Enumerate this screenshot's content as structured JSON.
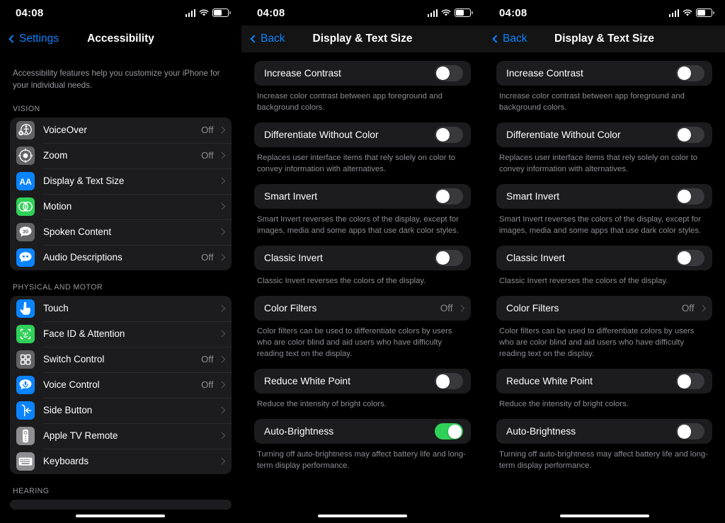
{
  "colors": {
    "accent_blue": "#0a84ff",
    "toggle_on_green": "#30d158",
    "card_bg": "#1c1c1e",
    "secondary_text": "#8d8d93",
    "screen_bg": "#000000"
  },
  "status_bar": {
    "time": "04:08",
    "signal_icon": "cellular-signal-icon",
    "wifi_icon": "wifi-icon",
    "battery_icon": "battery-icon"
  },
  "panel1": {
    "nav": {
      "back_label": "Settings",
      "title": "Accessibility"
    },
    "intro": "Accessibility features help you customize your iPhone for your individual needs.",
    "sections": [
      {
        "header": "VISION",
        "rows": [
          {
            "label": "VoiceOver",
            "value": "Off",
            "icon": "voiceover-icon",
            "icon_bg": "#636366"
          },
          {
            "label": "Zoom",
            "value": "Off",
            "icon": "zoom-icon",
            "icon_bg": "#636366"
          },
          {
            "label": "Display & Text Size",
            "value": "",
            "icon": "display-text-size-icon",
            "icon_bg": "#0a84ff"
          },
          {
            "label": "Motion",
            "value": "",
            "icon": "motion-icon",
            "icon_bg": "#30d158"
          },
          {
            "label": "Spoken Content",
            "value": "",
            "icon": "spoken-content-icon",
            "icon_bg": "#636366"
          },
          {
            "label": "Audio Descriptions",
            "value": "Off",
            "icon": "audio-descriptions-icon",
            "icon_bg": "#0a84ff"
          }
        ]
      },
      {
        "header": "PHYSICAL AND MOTOR",
        "rows": [
          {
            "label": "Touch",
            "value": "",
            "icon": "touch-icon",
            "icon_bg": "#0a84ff"
          },
          {
            "label": "Face ID & Attention",
            "value": "",
            "icon": "face-id-icon",
            "icon_bg": "#30d158"
          },
          {
            "label": "Switch Control",
            "value": "Off",
            "icon": "switch-control-icon",
            "icon_bg": "#636366"
          },
          {
            "label": "Voice Control",
            "value": "Off",
            "icon": "voice-control-icon",
            "icon_bg": "#0a84ff"
          },
          {
            "label": "Side Button",
            "value": "",
            "icon": "side-button-icon",
            "icon_bg": "#0a84ff"
          },
          {
            "label": "Apple TV Remote",
            "value": "",
            "icon": "apple-tv-remote-icon",
            "icon_bg": "#8e8e93"
          },
          {
            "label": "Keyboards",
            "value": "",
            "icon": "keyboards-icon",
            "icon_bg": "#8e8e93"
          }
        ]
      },
      {
        "header": "HEARING",
        "rows": []
      }
    ]
  },
  "panel2": {
    "nav": {
      "back_label": "Back",
      "title": "Display & Text Size"
    },
    "rows": [
      {
        "label": "Increase Contrast",
        "control": "toggle",
        "toggle_on": false,
        "description": "Increase color contrast between app foreground and background colors."
      },
      {
        "label": "Differentiate Without Color",
        "control": "toggle",
        "toggle_on": false,
        "description": "Replaces user interface items that rely solely on color to convey information with alternatives."
      },
      {
        "label": "Smart Invert",
        "control": "toggle",
        "toggle_on": false,
        "description": "Smart Invert reverses the colors of the display, except for images, media and some apps that use dark color styles."
      },
      {
        "label": "Classic Invert",
        "control": "toggle",
        "toggle_on": false,
        "description": "Classic Invert reverses the colors of the display."
      },
      {
        "label": "Color Filters",
        "control": "disclosure",
        "value": "Off",
        "description": "Color filters can be used to differentiate colors by users who are color blind and aid users who have difficulty reading text on the display."
      },
      {
        "label": "Reduce White Point",
        "control": "toggle",
        "toggle_on": false,
        "description": "Reduce the intensity of bright colors."
      },
      {
        "label": "Auto-Brightness",
        "control": "toggle",
        "toggle_on": true,
        "description": "Turning off auto-brightness may affect battery life and long-term display performance."
      }
    ]
  },
  "panel3": {
    "nav": {
      "back_label": "Back",
      "title": "Display & Text Size"
    },
    "rows": [
      {
        "label": "Increase Contrast",
        "control": "toggle",
        "toggle_on": false,
        "description": "Increase color contrast between app foreground and background colors."
      },
      {
        "label": "Differentiate Without Color",
        "control": "toggle",
        "toggle_on": false,
        "description": "Replaces user interface items that rely solely on color to convey information with alternatives."
      },
      {
        "label": "Smart Invert",
        "control": "toggle",
        "toggle_on": false,
        "description": "Smart Invert reverses the colors of the display, except for images, media and some apps that use dark color styles."
      },
      {
        "label": "Classic Invert",
        "control": "toggle",
        "toggle_on": false,
        "description": "Classic Invert reverses the colors of the display."
      },
      {
        "label": "Color Filters",
        "control": "disclosure",
        "value": "Off",
        "description": "Color filters can be used to differentiate colors by users who are color blind and aid users who have difficulty reading text on the display."
      },
      {
        "label": "Reduce White Point",
        "control": "toggle",
        "toggle_on": false,
        "description": "Reduce the intensity of bright colors."
      },
      {
        "label": "Auto-Brightness",
        "control": "toggle",
        "toggle_on": false,
        "description": "Turning off auto-brightness may affect battery life and long-term display performance."
      }
    ]
  }
}
